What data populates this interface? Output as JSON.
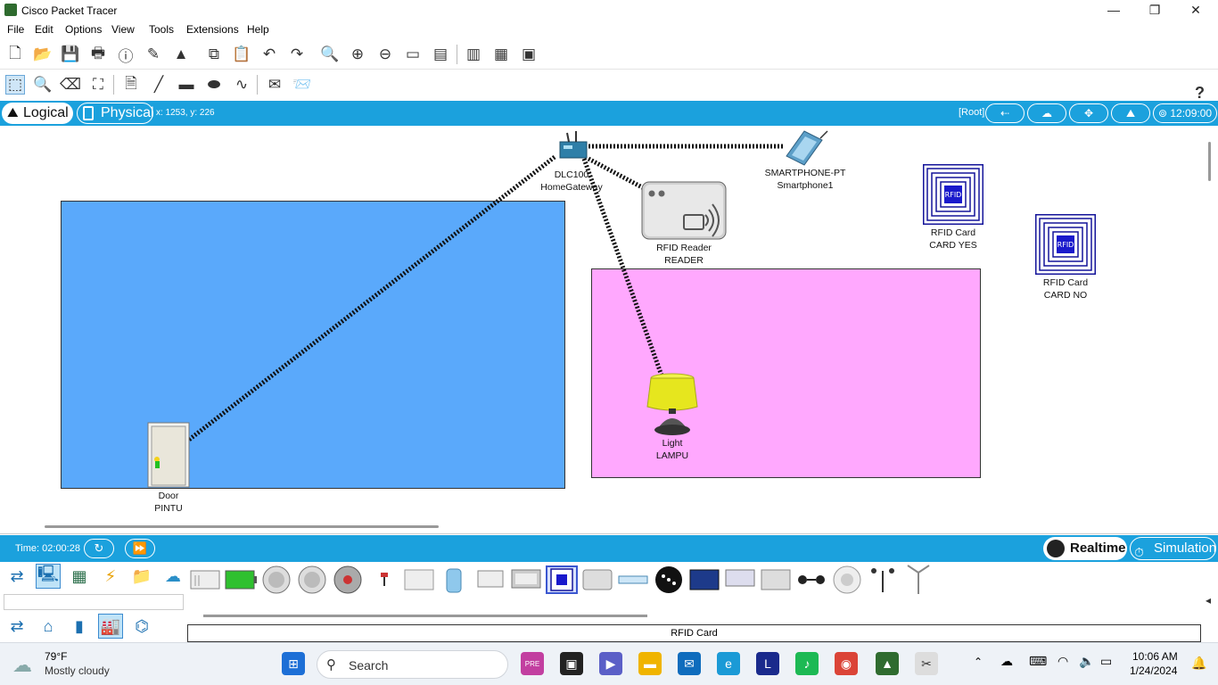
{
  "window": {
    "title": "Cisco Packet Tracer",
    "minimize": "—",
    "maximize": "❐",
    "close": "✕"
  },
  "menu": [
    "File",
    "Edit",
    "Options",
    "View",
    "Tools",
    "Extensions",
    "Help"
  ],
  "help_icon": "?",
  "workspace": {
    "logical_tab": "Logical",
    "physical_tab": "Physical",
    "coords": "x: 1253, y: 226",
    "root": "[Root]",
    "clock": "12:09:00"
  },
  "devices": [
    {
      "id": "gateway",
      "type": "DLC100",
      "name": "HomeGateway"
    },
    {
      "id": "smartphone",
      "type": "SMARTPHONE-PT",
      "name": "Smartphone1"
    },
    {
      "id": "reader",
      "type": "RFID Reader",
      "name": "READER"
    },
    {
      "id": "card-yes",
      "type": "RFID Card",
      "name": "CARD YES"
    },
    {
      "id": "card-no",
      "type": "RFID Card",
      "name": "CARD NO"
    },
    {
      "id": "light",
      "type": "Light",
      "name": "LAMPU"
    },
    {
      "id": "door",
      "type": "Door",
      "name": "PINTU"
    }
  ],
  "colors": {
    "room1": "#5aa9fb",
    "room2": "#ffa8fe",
    "bar": "#1ba1dd"
  },
  "timebar": {
    "time": "Time: 02:00:28",
    "realtime": "Realtime",
    "simulation": "Simulation"
  },
  "palette": {
    "selected_type": "RFID Card",
    "card_icon_label": "RFID"
  },
  "taskbar": {
    "weather_temp": "79°F",
    "weather_desc": "Mostly cloudy",
    "search": "Search",
    "time": "10:06 AM",
    "date": "1/24/2024",
    "pre_badge": "PRE",
    "l_icon": "L"
  }
}
